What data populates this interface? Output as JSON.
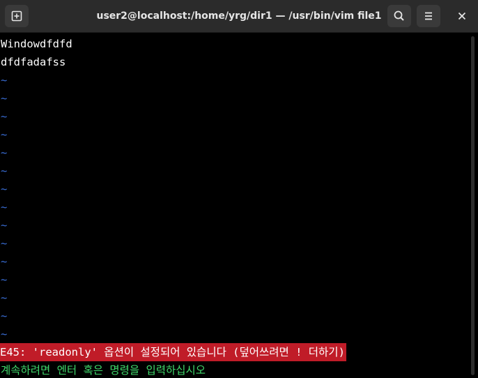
{
  "window": {
    "title": "user2@localhost:/home/yrg/dir1 — /usr/bin/vim file1"
  },
  "titlebar": {
    "new_tab_icon": "new-tab-icon",
    "search_icon": "search-icon",
    "menu_icon": "hamburger-menu-icon",
    "close_icon": "close-icon"
  },
  "buffer": {
    "lines": [
      "Windowdfdfd",
      "dfdfadafss"
    ],
    "tilde": "~"
  },
  "status": {
    "error": "E45: 'readonly' 옵션이 설정되어 있습니다 (덮어쓰려면 ! 더하기)",
    "prompt": "계속하려면 엔터 혹은 명령을 입력하십시오"
  },
  "colors": {
    "tilde": "#3a6fd8",
    "error_bg": "#c01c28",
    "prompt_fg": "#3fd96b"
  }
}
